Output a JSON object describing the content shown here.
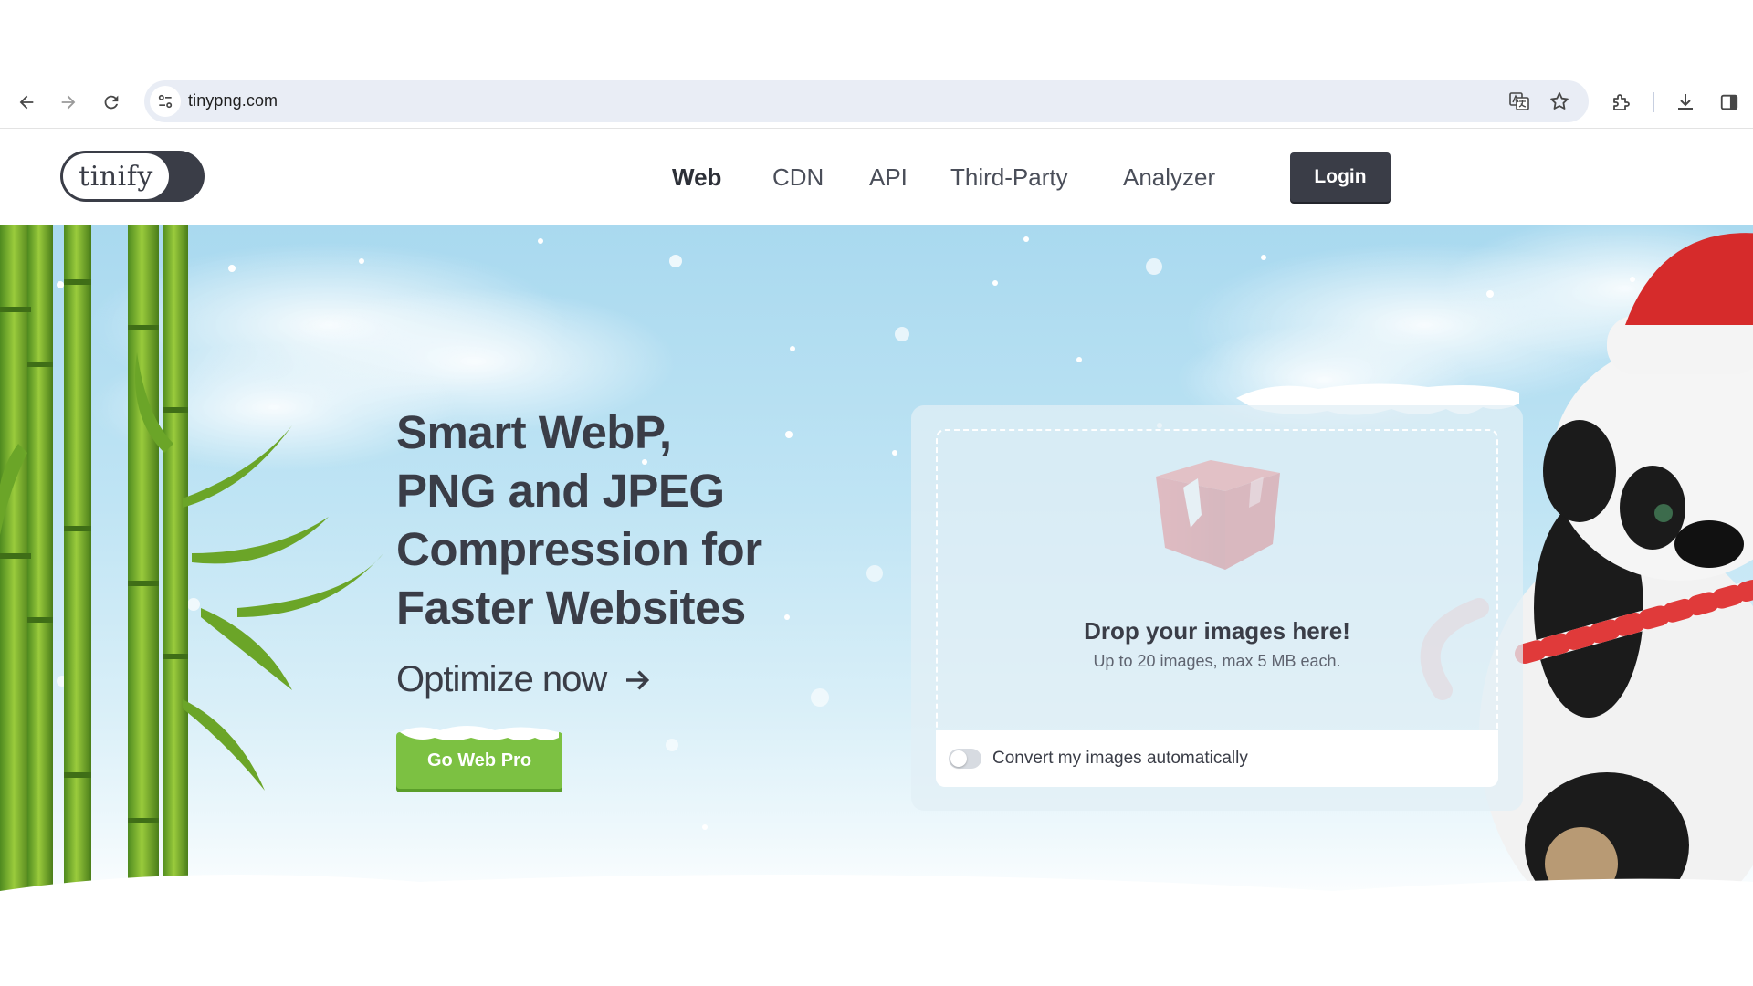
{
  "browser": {
    "url": "tinypng.com"
  },
  "site": {
    "logo_text": "tinify",
    "menu": [
      {
        "label": "Web"
      },
      {
        "label": "CDN"
      },
      {
        "label": "API"
      },
      {
        "label": "Third-Party"
      },
      {
        "label": "Analyzer"
      }
    ],
    "login_label": "Login"
  },
  "hero": {
    "headline_lines": [
      "Smart WebP,",
      "PNG and JPEG",
      "Compression for",
      "Faster Websites"
    ],
    "optimize_label": "Optimize now",
    "webpro_label": "Go Web Pro",
    "drop_title": "Drop your images here!",
    "drop_subtitle": "Up to 20 images, max 5 MB each.",
    "convert_label": "Convert my images automatically",
    "convert_enabled": false
  },
  "colors": {
    "brand_dark": "#3a3d47",
    "accent_green": "#7cc142",
    "sky": "#a9d9ef"
  }
}
